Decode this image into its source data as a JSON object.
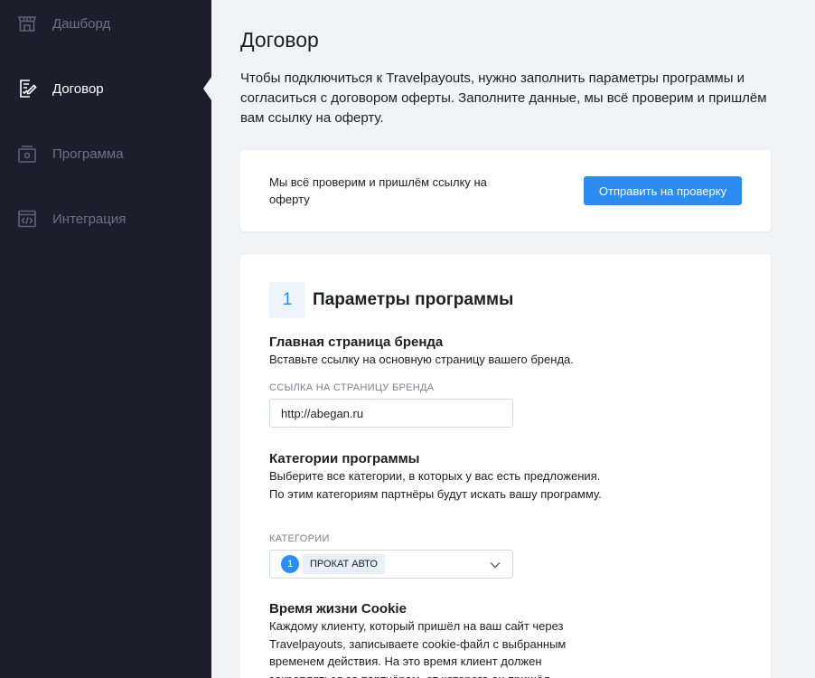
{
  "sidebar": {
    "items": [
      {
        "label": "Дашборд",
        "icon": "store-icon",
        "active": false
      },
      {
        "label": "Договор",
        "icon": "contract-icon",
        "active": true
      },
      {
        "label": "Программа",
        "icon": "program-icon",
        "active": false
      },
      {
        "label": "Интеграция",
        "icon": "code-icon",
        "active": false
      }
    ]
  },
  "page": {
    "title": "Договор",
    "intro": "Чтобы подключиться к Travelpayouts, нужно заполнить параметры программы и согласиться с договором оферты. Заполните данные, мы всё проверим и пришлём вам ссылку на оферту."
  },
  "submit_card": {
    "text": "Мы всё проверим и пришлём ссылку на оферту",
    "button_label": "Отправить на проверку"
  },
  "params": {
    "step_number": "1",
    "title": "Параметры программы",
    "brand": {
      "title": "Главная страница бренда",
      "description": "Вставьте ссылку на основную страницу вашего бренда.",
      "field_label": "ССЫЛКА НА СТРАНИЦУ БРЕНДА",
      "value": "http://abegan.ru"
    },
    "categories": {
      "title": "Категории программы",
      "description": "Выберите все категории, в которых у вас есть предложения. По этим категориям партнёры будут искать вашу программу.",
      "field_label": "КАТЕГОРИИ",
      "count": "1",
      "selected": "ПРОКАТ АВТО"
    },
    "cookie": {
      "title": "Время жизни Cookie",
      "description": "Каждому клиенту, который пришёл на ваш сайт через Travelpayouts, записываете cookie-файл с выбранным временем действия. На это время клиент должен закрепляться за партнёром, от которого он пришёл."
    }
  },
  "colors": {
    "sidebar_bg": "#1c1e2c",
    "accent": "#2d8cf0",
    "page_bg": "#f2f3f6"
  }
}
